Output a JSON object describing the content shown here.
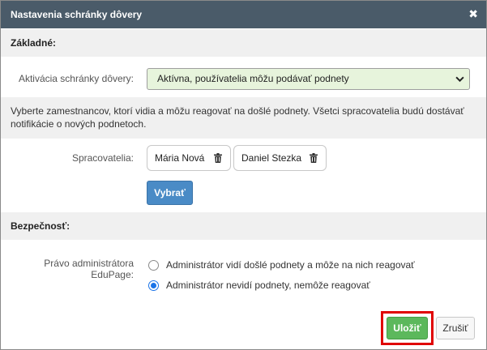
{
  "dialog": {
    "title": "Nastavenia schránky dôvery",
    "close_icon": "close-icon"
  },
  "basic": {
    "header": "Základné:",
    "activation_label": "Aktivácia schránky dôvery:",
    "activation_value": "Aktívna, používatelia môžu podávať podnety",
    "activation_bg": "#e7f4dc"
  },
  "info_text": "Vyberte zamestnancov, ktorí vidia a môžu reagovať na došlé podnety. Všetci spracovatelia budú dostávať notifikácie o nových podnetoch.",
  "processors": {
    "label": "Spracovatelia:",
    "items": [
      {
        "name": "Mária Nová",
        "icon": "trash-icon"
      },
      {
        "name": "Daniel Stezka",
        "icon": "trash-icon"
      }
    ],
    "select_button": "Vybrať"
  },
  "security": {
    "header": "Bezpečnosť:",
    "admin_label_line1": "Právo administrátora",
    "admin_label_line2": "EduPage:",
    "options": [
      {
        "label": "Administrátor vidí došlé podnety a môže na nich reagovať",
        "checked": false
      },
      {
        "label": "Administrátor nevidí podnety, nemôže reagovať",
        "checked": true
      }
    ]
  },
  "footer": {
    "save_label": "Uložiť",
    "cancel_label": "Zrušiť",
    "save_color": "#5cb85c",
    "highlight_color": "#e00000"
  },
  "colors": {
    "titlebar": "#4a5b69",
    "primary_button": "#4a8bc6",
    "radio_accent": "#1a73e8"
  }
}
